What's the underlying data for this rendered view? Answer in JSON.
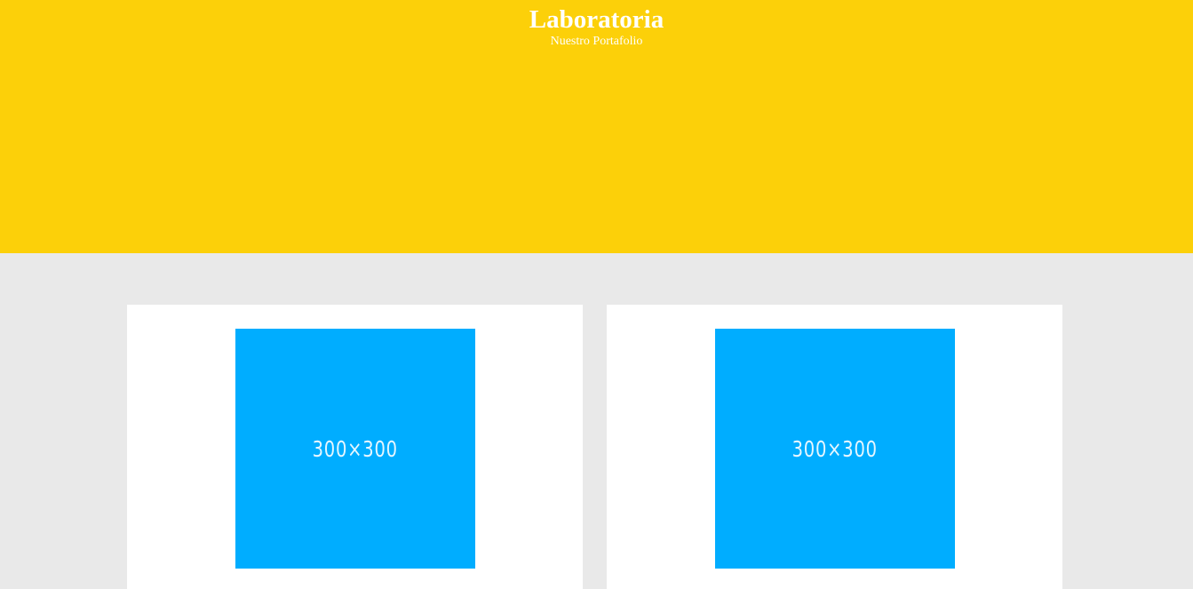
{
  "header": {
    "title": "Laboratoria",
    "subtitle": "Nuestro Portafolio"
  },
  "portfolio": {
    "items": [
      {
        "image_label": "300×300"
      },
      {
        "image_label": "300×300"
      }
    ]
  },
  "colors": {
    "header_bg": "#fcd009",
    "page_bg": "#e9e9e9",
    "card_bg": "#ffffff",
    "placeholder_bg": "#00adff"
  }
}
